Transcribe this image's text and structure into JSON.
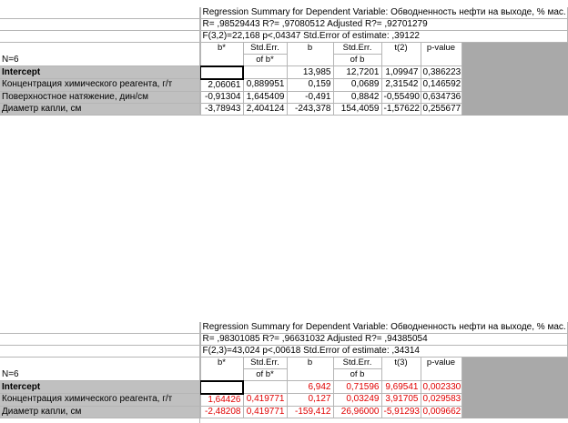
{
  "tables": [
    {
      "summary_lines": [
        "Regression Summary for Dependent Variable: Обводненность нефти на выходе, % мас.",
        "R= ,98529443 R?= ,97080512 Adjusted R?= ,92701279",
        "F(3,2)=22,168 p<,04347 Std.Error of estimate: ,39122"
      ],
      "n_label": "N=6",
      "headers": {
        "b_star": "b*",
        "se_b_star": [
          "Std.Err.",
          "of b*"
        ],
        "b": "b",
        "se_b": [
          "Std.Err.",
          "of b"
        ],
        "t": "t(2)",
        "p": "p-value"
      },
      "rows": [
        {
          "label": "Intercept",
          "b_star": "",
          "se_b_star": "",
          "b": "13,985",
          "se_b": "12,7201",
          "t": "1,09947",
          "p": "0,386223",
          "bold": true
        },
        {
          "label": "Концентрация химического реагента, г/т",
          "b_star": "2,06061",
          "se_b_star": "0,889951",
          "b": "0,159",
          "se_b": "0,0689",
          "t": "2,31542",
          "p": "0,146592"
        },
        {
          "label": "Поверхностное натяжение, дин/см",
          "b_star": "-0,91304",
          "se_b_star": "1,645409",
          "b": "-0,491",
          "se_b": "0,8842",
          "t": "-0,55490",
          "p": "0,634736"
        },
        {
          "label": "Диаметр капли, см",
          "b_star": "-3,78943",
          "se_b_star": "2,404124",
          "b": "-243,378",
          "se_b": "154,4059",
          "t": "-1,57622",
          "p": "0,255677"
        }
      ],
      "red": false
    },
    {
      "summary_lines": [
        "Regression Summary for Dependent Variable: Обводненность нефти на выходе, % мас.",
        "R= ,98301085 R?= ,96631032 Adjusted R?= ,94385054",
        "F(2,3)=43,024 p<,00618 Std.Error of estimate: ,34314"
      ],
      "n_label": "N=6",
      "headers": {
        "b_star": "b*",
        "se_b_star": [
          "Std.Err.",
          "of b*"
        ],
        "b": "b",
        "se_b": [
          "Std.Err.",
          "of b"
        ],
        "t": "t(3)",
        "p": "p-value"
      },
      "rows": [
        {
          "label": "Intercept",
          "b_star": "",
          "se_b_star": "",
          "b": "6,942",
          "se_b": "0,71596",
          "t": "9,69541",
          "p": "0,002330",
          "bold": true
        },
        {
          "label": "Концентрация химического реагента, г/т",
          "b_star": "1,64426",
          "se_b_star": "0,419771",
          "b": "0,127",
          "se_b": "0,03249",
          "t": "3,91705",
          "p": "0,029583"
        },
        {
          "label": "Диаметр капли, см",
          "b_star": "-2,48208",
          "se_b_star": "0,419771",
          "b": "-159,412",
          "se_b": "26,96000",
          "t": "-5,91293",
          "p": "0,009662"
        }
      ],
      "red": true
    }
  ],
  "colors": {
    "header_gray": "#c0c0c0",
    "empty_gray": "#a9a9a9",
    "highlight_red": "#e00000"
  }
}
